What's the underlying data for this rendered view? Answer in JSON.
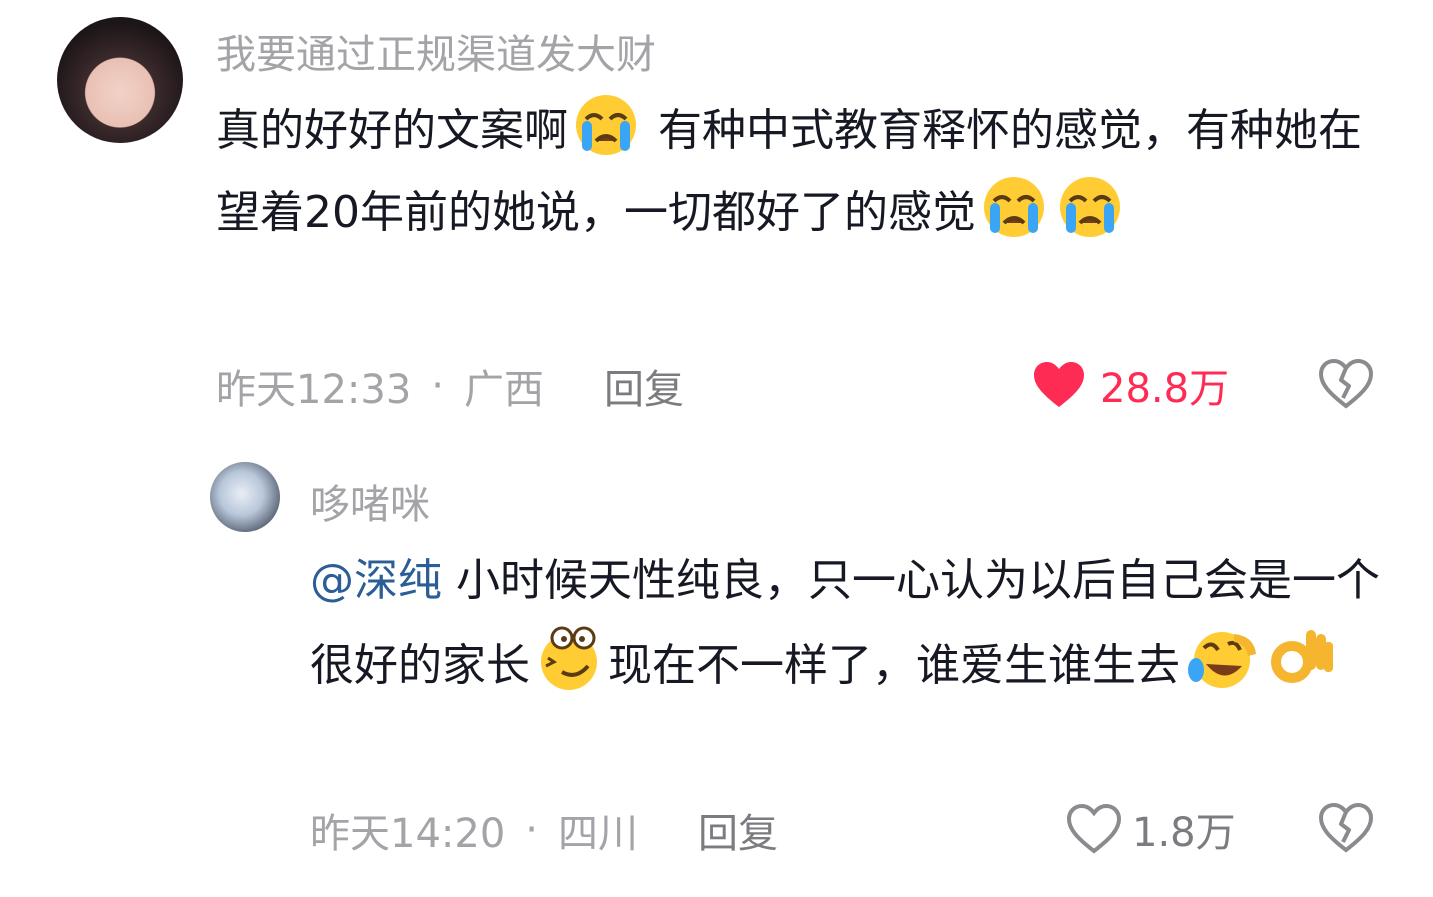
{
  "comments": [
    {
      "username": "我要通过正规渠道发大财",
      "text_part1": "真的好好的文案啊",
      "text_part2": " 有种中式教育释怀的感觉，有种她在望着20年前的她说，一切都好了的感觉",
      "time": "昨天12:33",
      "separator": "·",
      "location": "广西",
      "reply_label": "回复",
      "like_count": "28.8万",
      "liked": true
    },
    {
      "username": "哆啫咪",
      "mention": "@深纯",
      "text_part1": " 小时候天性纯良，只一心认为以后自己会是一个很好的家长",
      "text_part2": "现在不一样了，谁爱生谁生去",
      "time": "昨天14:20",
      "separator": "·",
      "location": "四川",
      "reply_label": "回复",
      "like_count": "1.8万",
      "liked": false
    }
  ],
  "icons": {
    "crying": "loudly-crying-face-emoji",
    "dizzy": "woozy-face-emoji",
    "laughing": "rolling-on-floor-laughing-emoji",
    "ok": "ok-hand-emoji",
    "heart_filled": "heart-filled-icon",
    "heart_outline": "heart-outline-icon",
    "broken_heart": "broken-heart-icon"
  },
  "colors": {
    "like_active": "#fe2c55",
    "meta_gray": "#a3a3a8",
    "mention_blue": "#2b5e96",
    "text": "#161823"
  }
}
